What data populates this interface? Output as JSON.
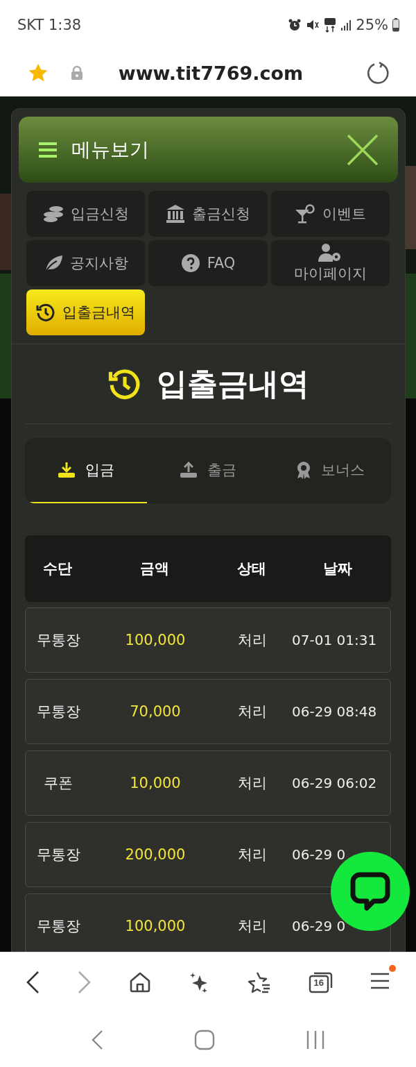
{
  "status_bar": {
    "carrier_time": "SKT 1:38",
    "battery": "25%"
  },
  "browser": {
    "url": "www.tit7769.com",
    "tab_count": "16"
  },
  "menu": {
    "title": "메뉴보기",
    "items": [
      {
        "label": "입금신청",
        "kind": "deposit",
        "selected": false
      },
      {
        "label": "출금신청",
        "kind": "withdraw",
        "selected": false
      },
      {
        "label": "이벤트",
        "kind": "event",
        "selected": false
      },
      {
        "label": "공지사항",
        "kind": "notice",
        "selected": false
      },
      {
        "label": "FAQ",
        "kind": "faq",
        "selected": false
      },
      {
        "label": "마이페이지",
        "kind": "mypage",
        "selected": false
      },
      {
        "label": "입출금내역",
        "kind": "history",
        "selected": true
      }
    ]
  },
  "page_title": "입출금내역",
  "tabs": [
    {
      "label": "입금",
      "kind": "deposit",
      "selected": true
    },
    {
      "label": "출금",
      "kind": "withdraw",
      "selected": false
    },
    {
      "label": "보너스",
      "kind": "bonus",
      "selected": false
    }
  ],
  "table": {
    "columns": [
      "수단",
      "금액",
      "상태",
      "날짜"
    ],
    "rows": [
      {
        "method": "무통장",
        "amount": "100,000",
        "status": "처리",
        "date": "07-01 01:31"
      },
      {
        "method": "무통장",
        "amount": "70,000",
        "status": "처리",
        "date": "06-29 08:48"
      },
      {
        "method": "쿠폰",
        "amount": "10,000",
        "status": "처리",
        "date": "06-29 06:02"
      },
      {
        "method": "무통장",
        "amount": "200,000",
        "status": "처리",
        "date": "06-29 0"
      },
      {
        "method": "무통장",
        "amount": "100,000",
        "status": "처리",
        "date": "06-29 0"
      }
    ]
  }
}
